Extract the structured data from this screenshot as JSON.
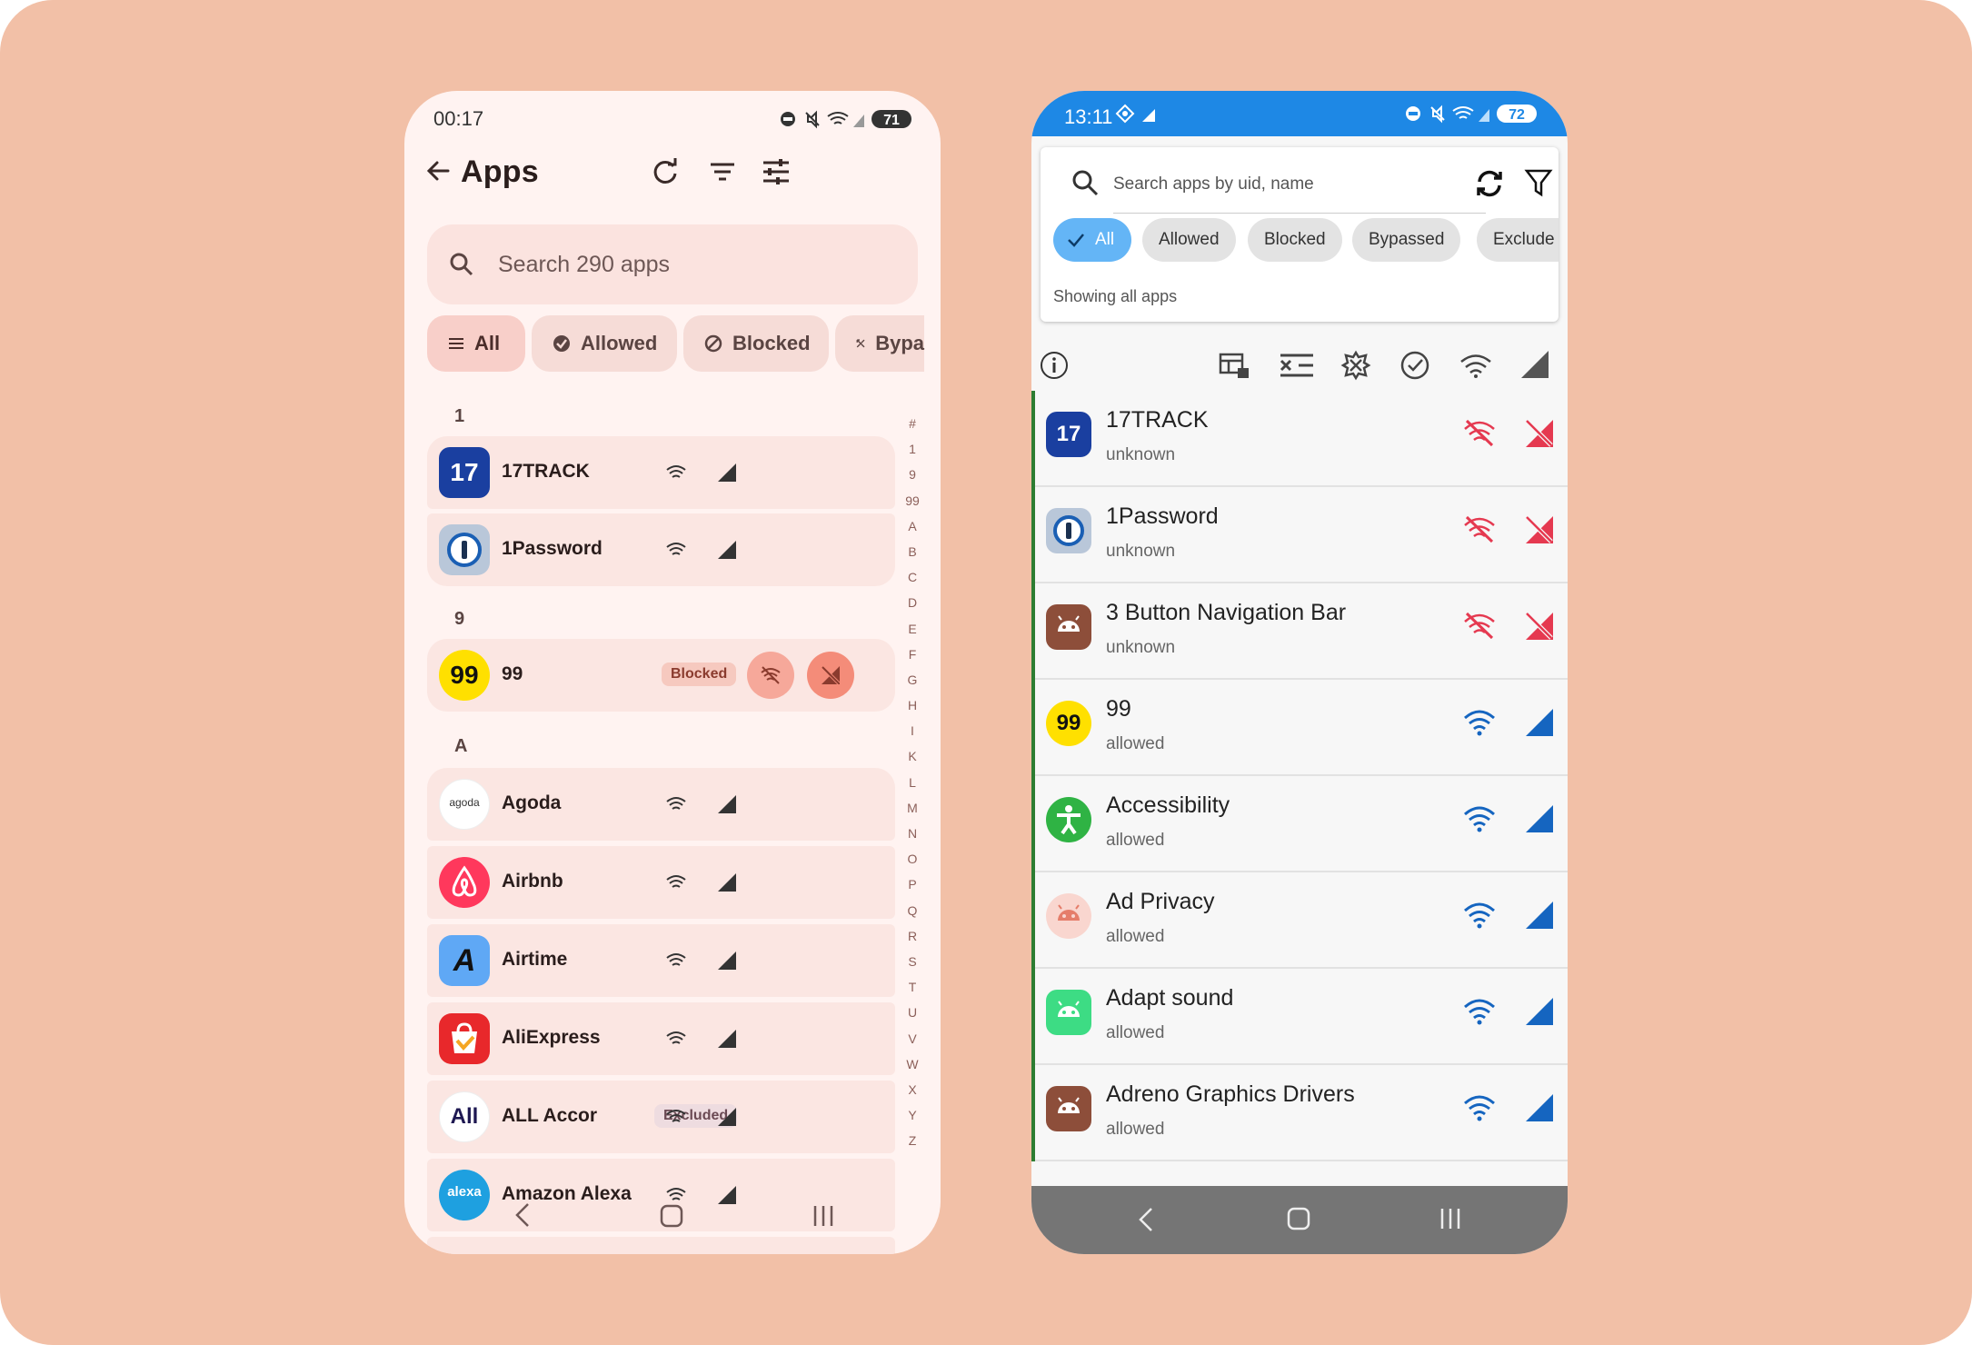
{
  "left_phone": {
    "status_time": "00:17",
    "battery": "71",
    "title": "Apps",
    "search_placeholder": "Search 290 apps",
    "filters": [
      "All",
      "Allowed",
      "Blocked",
      "Bypa"
    ],
    "icons": {
      "back": "arrow-back-icon",
      "refresh": "refresh-icon",
      "sort": "sort-icon",
      "tune": "tune-icon"
    },
    "sections": [
      {
        "letter": "1",
        "apps": [
          {
            "name": "17TRACK",
            "badge": "",
            "icon_text": "17"
          },
          {
            "name": "1Password",
            "badge": "",
            "icon_text": "1"
          }
        ]
      },
      {
        "letter": "9",
        "apps": [
          {
            "name": "99",
            "badge": "Blocked",
            "icon_text": "99"
          }
        ]
      },
      {
        "letter": "A",
        "apps": [
          {
            "name": "Agoda",
            "badge": "",
            "icon_text": "agoda"
          },
          {
            "name": "Airbnb",
            "badge": "",
            "icon_text": ""
          },
          {
            "name": "Airtime",
            "badge": "",
            "icon_text": "A"
          },
          {
            "name": "AliExpress",
            "badge": "",
            "icon_text": ""
          },
          {
            "name": "ALL Accor",
            "badge": "Excluded",
            "icon_text": "All"
          },
          {
            "name": "Amazon Alexa",
            "badge": "",
            "icon_text": "alexa"
          }
        ]
      }
    ],
    "az_index": [
      "#",
      "1",
      "9",
      "99",
      "A",
      "B",
      "C",
      "D",
      "E",
      "F",
      "G",
      "H",
      "I",
      "K",
      "L",
      "M",
      "N",
      "O",
      "P",
      "Q",
      "R",
      "S",
      "T",
      "U",
      "V",
      "W",
      "X",
      "Y",
      "Z"
    ]
  },
  "right_phone": {
    "status_time": "13:11",
    "battery": "72",
    "search_placeholder": "Search apps by uid, name",
    "filters": [
      "All",
      "Allowed",
      "Blocked",
      "Bypassed",
      "Exclude"
    ],
    "showing_text": "Showing all apps",
    "apps": [
      {
        "name": "17TRACK",
        "status": "unknown",
        "blocked": true
      },
      {
        "name": "1Password",
        "status": "unknown",
        "blocked": true
      },
      {
        "name": "3 Button Navigation Bar",
        "status": "unknown",
        "blocked": true
      },
      {
        "name": "99",
        "status": "allowed",
        "blocked": false
      },
      {
        "name": "Accessibility",
        "status": "allowed",
        "blocked": false
      },
      {
        "name": "Ad Privacy",
        "status": "allowed",
        "blocked": false
      },
      {
        "name": "Adapt sound",
        "status": "allowed",
        "blocked": false
      },
      {
        "name": "Adreno Graphics Drivers",
        "status": "allowed",
        "blocked": false
      }
    ]
  },
  "colors": {
    "background": "#f2c0a7",
    "blue": "#1e88e5",
    "blocked_red": "#e53950",
    "allowed_blue": "#1565c0"
  }
}
